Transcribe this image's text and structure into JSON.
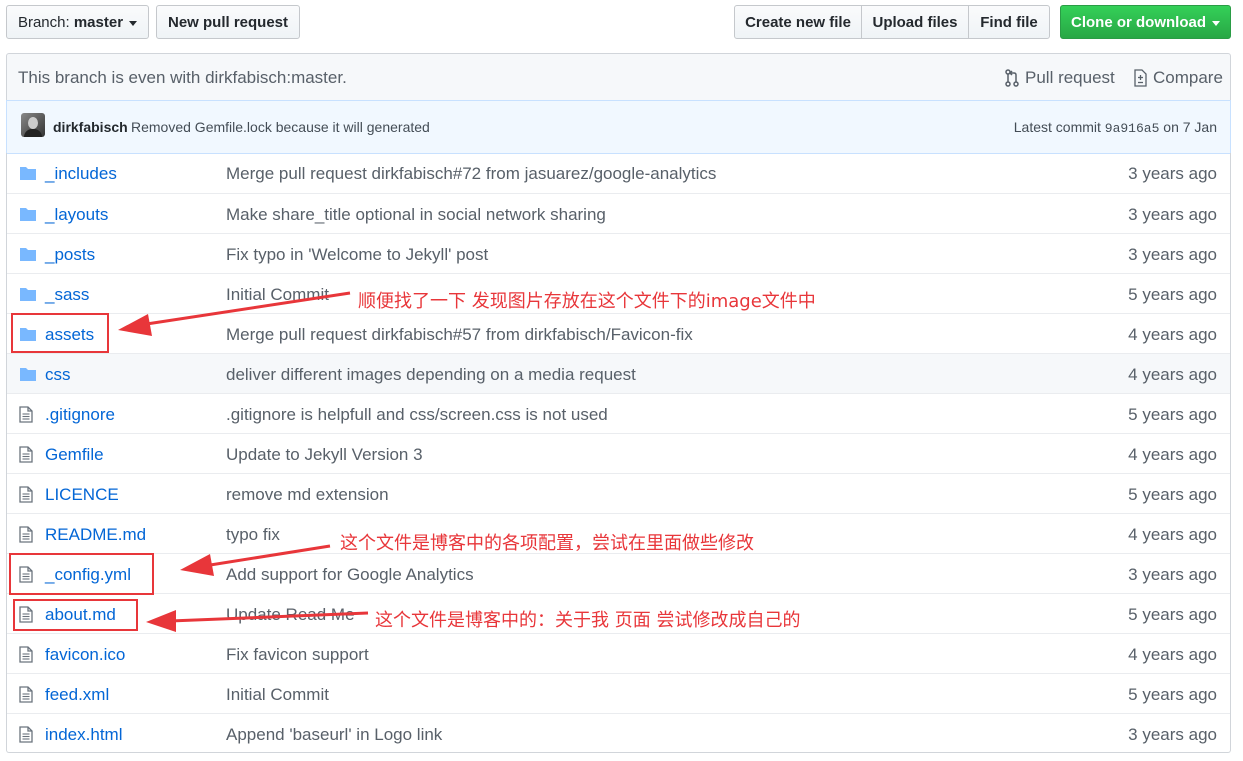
{
  "toolbar": {
    "branch_prefix": "Branch:",
    "branch_name": "master",
    "new_pr": "New pull request",
    "create_file": "Create new file",
    "upload_files": "Upload files",
    "find_file": "Find file",
    "clone": "Clone or download"
  },
  "branch_info": {
    "message": "This branch is even with dirkfabisch:master.",
    "pull_request": "Pull request",
    "compare": "Compare"
  },
  "commit": {
    "author": "dirkfabisch",
    "message": "Removed Gemfile.lock because it will generated",
    "latest_prefix": "Latest commit",
    "sha": "9a916a5",
    "date": "on 7 Jan"
  },
  "files": [
    {
      "name": "_includes",
      "type": "dir",
      "msg": "Merge pull request dirkfabisch#72 from jasuarez/google-analytics",
      "age": "3 years ago"
    },
    {
      "name": "_layouts",
      "type": "dir",
      "msg": "Make share_title optional in social network sharing",
      "age": "3 years ago"
    },
    {
      "name": "_posts",
      "type": "dir",
      "msg": "Fix typo in 'Welcome to Jekyll' post",
      "age": "3 years ago"
    },
    {
      "name": "_sass",
      "type": "dir",
      "msg": "Initial Commit",
      "age": "5 years ago"
    },
    {
      "name": "assets",
      "type": "dir",
      "msg": "Merge pull request dirkfabisch#57 from dirkfabisch/Favicon-fix",
      "age": "4 years ago"
    },
    {
      "name": "css",
      "type": "dir",
      "msg": "deliver different images depending on a media request",
      "age": "4 years ago"
    },
    {
      "name": ".gitignore",
      "type": "file",
      "msg": ".gitignore is helpfull and css/screen.css is not used",
      "age": "5 years ago"
    },
    {
      "name": "Gemfile",
      "type": "file",
      "msg": "Update to Jekyll Version 3",
      "age": "4 years ago"
    },
    {
      "name": "LICENCE",
      "type": "file",
      "msg": "remove md extension",
      "age": "5 years ago"
    },
    {
      "name": "README.md",
      "type": "file",
      "msg": "typo fix",
      "age": "4 years ago"
    },
    {
      "name": "_config.yml",
      "type": "file",
      "msg": "Add support for Google Analytics",
      "age": "3 years ago"
    },
    {
      "name": "about.md",
      "type": "file",
      "msg": "Update Read Me",
      "age": "5 years ago"
    },
    {
      "name": "favicon.ico",
      "type": "file",
      "msg": "Fix favicon support",
      "age": "4 years ago"
    },
    {
      "name": "feed.xml",
      "type": "file",
      "msg": "Initial Commit",
      "age": "5 years ago"
    },
    {
      "name": "index.html",
      "type": "file",
      "msg": "Append 'baseurl' in Logo link",
      "age": "3 years ago"
    }
  ],
  "annotations": {
    "assets_note": "顺便找了一下 发现图片存放在这个文件下的image文件中",
    "config_note": "这个文件是博客中的各项配置，尝试在里面做些修改",
    "about_note": "这个文件是博客中的：关于我 页面 尝试修改成自己的"
  },
  "colors": {
    "link": "#0366d6",
    "annotation": "#e8363a",
    "folder": "#79b8ff",
    "primary_button": "#28a745"
  }
}
